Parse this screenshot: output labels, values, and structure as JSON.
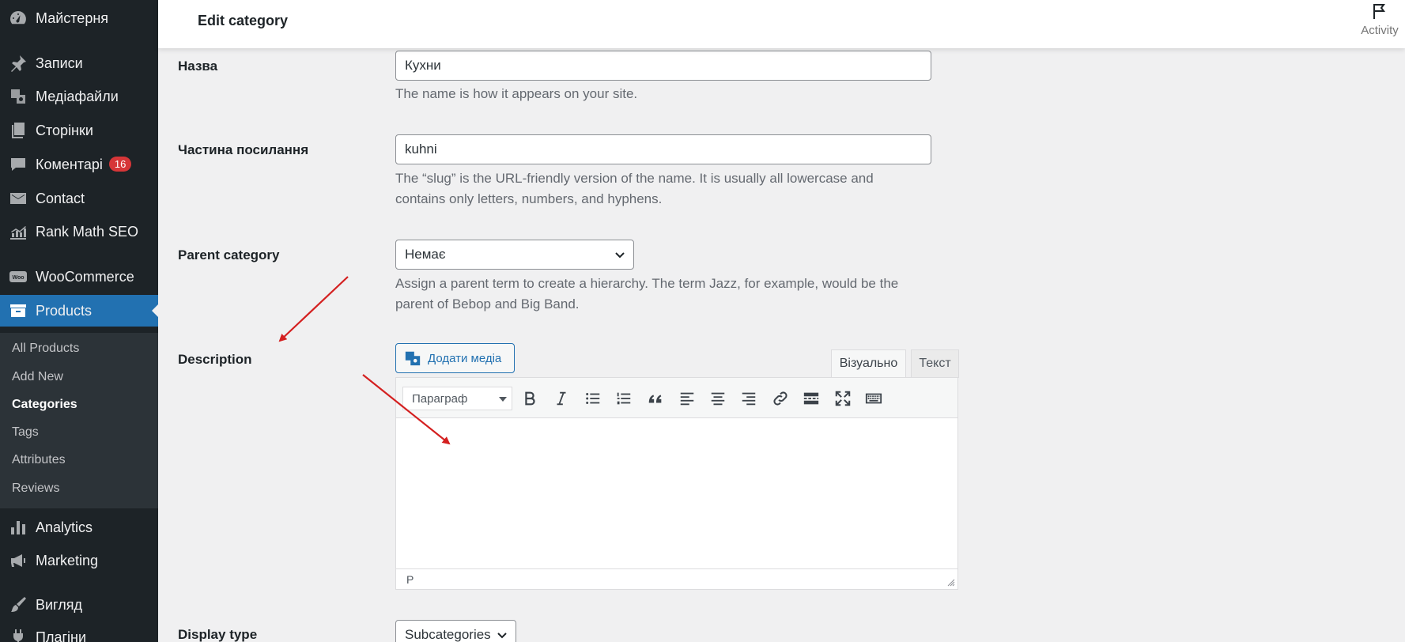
{
  "sidebar": {
    "dashboard": "Майстерня",
    "posts": "Записи",
    "media": "Медіафайли",
    "pages": "Сторінки",
    "comments": "Коментарі",
    "comments_badge": "16",
    "contact": "Contact",
    "rankmath": "Rank Math SEO",
    "woocommerce": "WooCommerce",
    "products": "Products",
    "submenu": {
      "all_products": "All Products",
      "add_new": "Add New",
      "categories": "Categories",
      "tags": "Tags",
      "attributes": "Attributes",
      "reviews": "Reviews"
    },
    "analytics": "Analytics",
    "marketing": "Marketing",
    "appearance": "Вигляд",
    "plugins": "Плагіни"
  },
  "header": {
    "title": "Edit category",
    "activity": "Activity"
  },
  "form": {
    "name": {
      "label": "Назва",
      "value": "Кухни",
      "help": "The name is how it appears on your site."
    },
    "slug": {
      "label": "Частина посилання",
      "value": "kuhni",
      "help_line1": "The “slug” is the URL-friendly version of the name. It is usually all lowercase and",
      "help_line2": "contains only letters, numbers, and hyphens."
    },
    "parent": {
      "label": "Parent category",
      "value": "Немає",
      "help_line1": "Assign a parent term to create a hierarchy. The term Jazz, for example, would be the",
      "help_line2": "parent of Bebop and Big Band."
    },
    "description": {
      "label": "Description",
      "add_media": "Додати медіа",
      "tab_visual": "Візуально",
      "tab_text": "Текст",
      "format": "Параграф",
      "path": "P"
    },
    "display_type": {
      "label": "Display type",
      "value": "Subcategories"
    }
  },
  "colors": {
    "sidebar_bg": "#1d2327",
    "active": "#2271b1",
    "badge": "#d63638",
    "arrow": "#d42020"
  }
}
